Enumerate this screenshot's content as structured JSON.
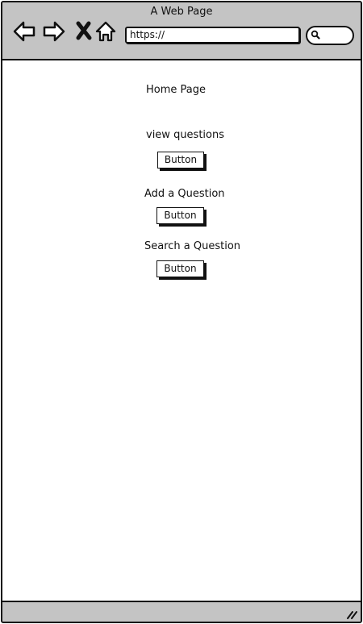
{
  "window": {
    "title": "A Web Page"
  },
  "toolbar": {
    "back_icon": "back-arrow-icon",
    "forward_icon": "forward-arrow-icon",
    "stop_icon": "close-x-icon",
    "home_icon": "home-icon",
    "url_value": "https://",
    "search_icon": "search-icon"
  },
  "main": {
    "heading": "Home Page",
    "sections": [
      {
        "label": "view questions",
        "button_label": "Button"
      },
      {
        "label": "Add a Question",
        "button_label": "Button"
      },
      {
        "label": "Search a Question",
        "button_label": "Button"
      }
    ]
  },
  "statusbar": {
    "grip_icon": "resize-grip-icon"
  }
}
